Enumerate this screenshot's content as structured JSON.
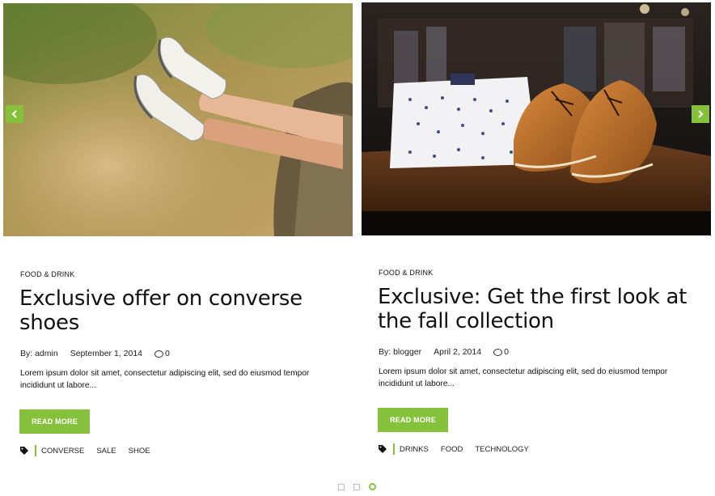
{
  "posts": [
    {
      "category": "FOOD & DRINK",
      "title": "Exclusive offer on converse shoes",
      "author": "By: admin",
      "date": "September 1, 2014",
      "comments": "0",
      "excerpt": "Lorem ipsum dolor sit amet, consectetur adipiscing elit, sed do eiusmod tempor incididunt ut labore...",
      "read_more": "READ MORE",
      "tags": [
        "CONVERSE",
        "SALE",
        "SHOE"
      ]
    },
    {
      "category": "FOOD & DRINK",
      "title": "Exclusive: Get the first look at the fall collection",
      "author": "By: blogger",
      "date": "April 2, 2014",
      "comments": "0",
      "excerpt": "Lorem ipsum dolor sit amet, consectetur adipiscing elit, sed do eiusmod tempor incididunt ut labore...",
      "read_more": "READ MORE",
      "tags": [
        "DRINKS",
        "FOOD",
        "TECHNOLOGY"
      ]
    }
  ],
  "navigation": {
    "prev_icon": "chevron-left-icon",
    "next_icon": "chevron-right-icon"
  },
  "pagination": {
    "total": 3,
    "active": 3
  },
  "colors": {
    "accent": "#86c13c"
  }
}
